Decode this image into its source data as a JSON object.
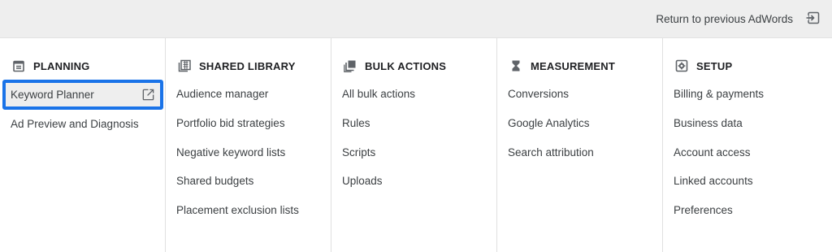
{
  "topbar": {
    "return_label": "Return to previous AdWords",
    "return_icon": "exit-icon"
  },
  "columns": [
    {
      "title": "PLANNING",
      "icon": "calendar-icon",
      "items": [
        {
          "label": "Keyword Planner",
          "highlighted": true,
          "external_icon": "open-in-new-icon"
        },
        {
          "label": "Ad Preview and Diagnosis"
        }
      ]
    },
    {
      "title": "SHARED LIBRARY",
      "icon": "library-grid-icon",
      "items": [
        {
          "label": "Audience manager"
        },
        {
          "label": "Portfolio bid strategies"
        },
        {
          "label": "Negative keyword lists"
        },
        {
          "label": "Shared budgets"
        },
        {
          "label": "Placement exclusion lists"
        }
      ]
    },
    {
      "title": "BULK ACTIONS",
      "icon": "copy-stack-icon",
      "items": [
        {
          "label": "All bulk actions"
        },
        {
          "label": "Rules"
        },
        {
          "label": "Scripts"
        },
        {
          "label": "Uploads"
        }
      ]
    },
    {
      "title": "MEASUREMENT",
      "icon": "hourglass-icon",
      "items": [
        {
          "label": "Conversions"
        },
        {
          "label": "Google Analytics"
        },
        {
          "label": "Search attribution"
        }
      ]
    },
    {
      "title": "SETUP",
      "icon": "settings-icon",
      "items": [
        {
          "label": "Billing & payments"
        },
        {
          "label": "Business data"
        },
        {
          "label": "Account access"
        },
        {
          "label": "Linked accounts"
        },
        {
          "label": "Preferences"
        }
      ]
    }
  ],
  "colors": {
    "highlight_border": "#1a73e8",
    "topbar_bg": "#eeeeee",
    "text": "#3c4043"
  }
}
